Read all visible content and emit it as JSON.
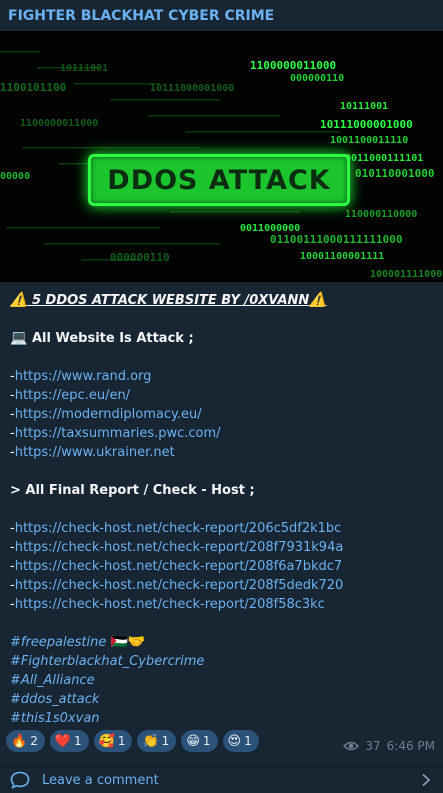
{
  "channel": {
    "name": "FIGHTER BLACKHAT CYBER CRIME"
  },
  "banner": {
    "title": "DDOS ATTACK",
    "binary_rows": [
      "1100000011000",
      "000000110",
      "10111001",
      "10111000001000",
      "1001100011110",
      "0011000111101",
      "010110001000",
      "00000",
      "0011000000",
      "01100111000111111000",
      "10001100001111",
      "110000110000",
      "1100101100",
      "1000011110000"
    ]
  },
  "post": {
    "title_emoji": "⚠️",
    "title": "5 DDOS ATTACK WEBSITE BY /0XVANN",
    "title_emoji_end": "⚠️",
    "section1_icon": "laptop-icon",
    "section1_emoji": "💻",
    "section1_label": "All Website Is Attack ;",
    "websites": [
      "https://www.rand.org",
      "https://epc.eu/en/",
      "https://moderndiplomacy.eu/",
      "https://taxsummaries.pwc.com/",
      "https://www.ukrainer.net"
    ],
    "section2_label": "> All Final Report / Check - Host ;",
    "reports": [
      "https://check-host.net/check-report/206c5df2k1bc",
      "https://check-host.net/check-report/208f7931k94a",
      "https://check-host.net/check-report/208f6a7bkdc7",
      "https://check-host.net/check-report/208f5dedk720",
      "https://check-host.net/check-report/208f58c3kc"
    ],
    "line_prefix": "-",
    "hashtags": [
      {
        "text": "#freepalestine",
        "emoji": "🇵🇸🤝"
      },
      {
        "text": "#Fighterblackhat_Cybercrime",
        "emoji": ""
      },
      {
        "text": "#All_Alliance",
        "emoji": ""
      },
      {
        "text": "#ddos_attack",
        "emoji": ""
      },
      {
        "text": "#this1s0xvan",
        "emoji": ""
      }
    ]
  },
  "reactions": [
    {
      "emoji": "🔥",
      "count": "2"
    },
    {
      "emoji": "❤️",
      "count": "1"
    },
    {
      "emoji": "🥰",
      "count": "1"
    },
    {
      "emoji": "👏",
      "count": "1"
    },
    {
      "emoji": "😁",
      "count": "1"
    },
    {
      "emoji": "😍",
      "count": "1"
    }
  ],
  "meta": {
    "views": "37",
    "time": "6:46 PM",
    "views_icon": "eye-icon"
  },
  "footer": {
    "comment_label": "Leave a comment",
    "comment_icon": "comment-bubble-icon",
    "chevron_icon": "chevron-right-icon"
  },
  "colors": {
    "accent": "#6ab2f2",
    "background": "#182533",
    "reaction_bg": "#2b5278",
    "banner_green": "#2dff45"
  }
}
